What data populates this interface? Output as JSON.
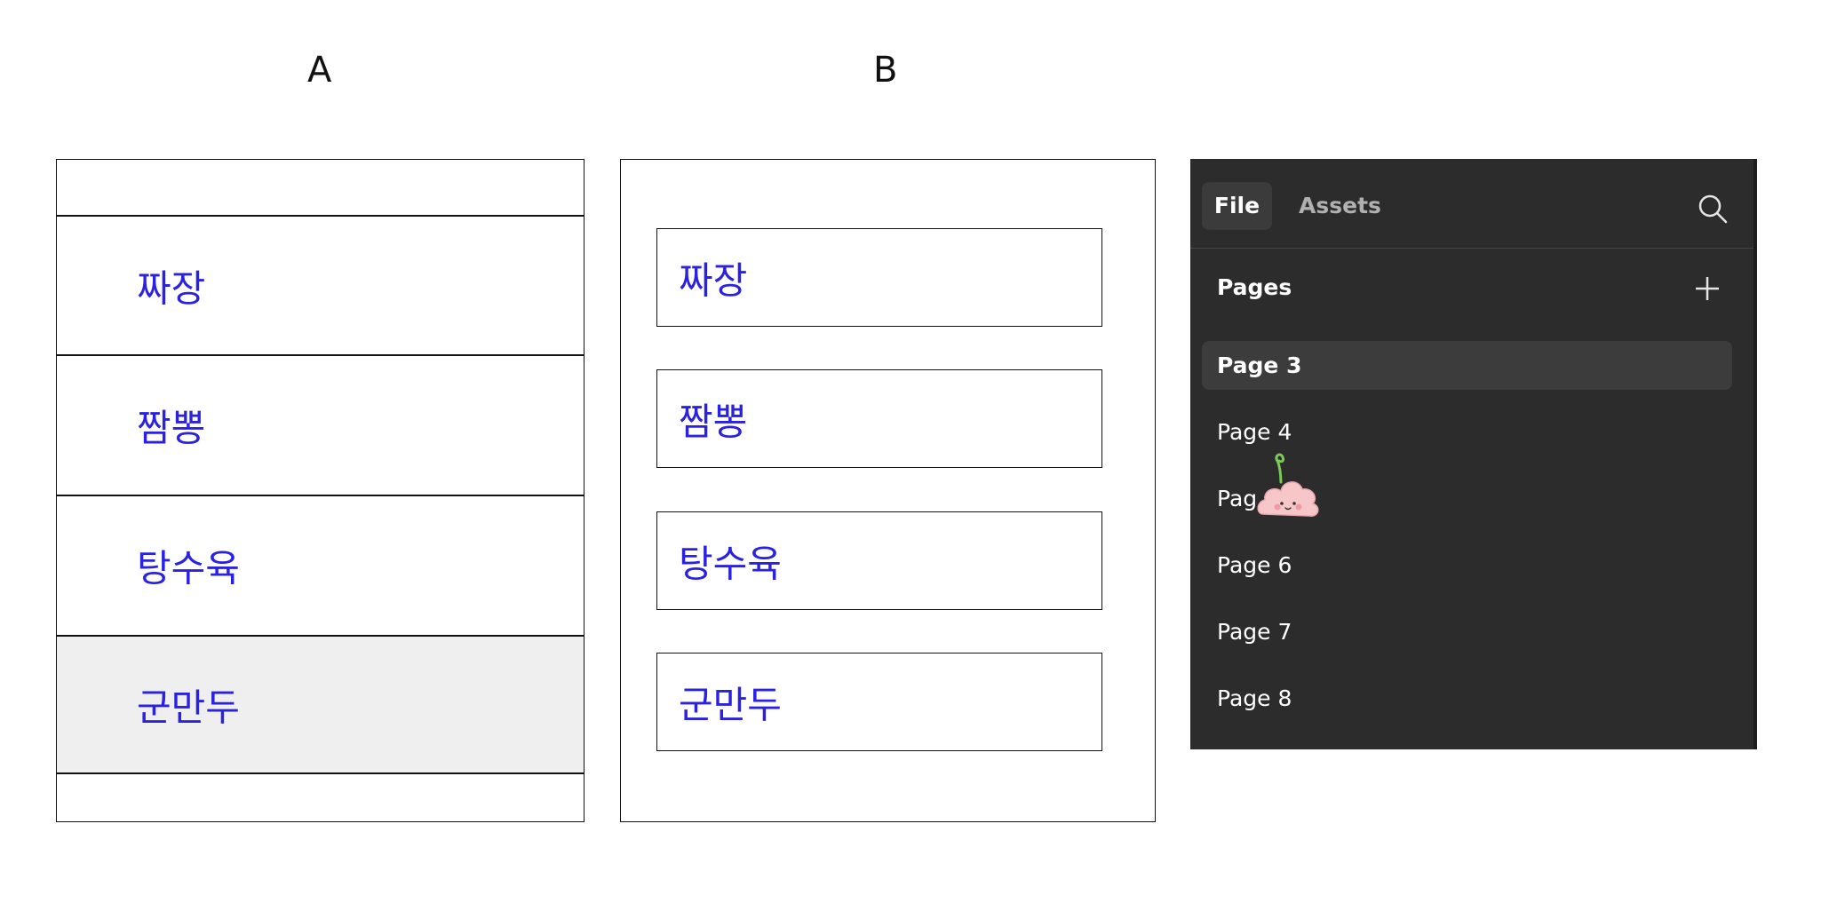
{
  "labels": {
    "a": "A",
    "b": "B"
  },
  "panel_a": {
    "rows": [
      "짜장",
      "짬뽕",
      "탕수육",
      "군만두"
    ]
  },
  "panel_b": {
    "items": [
      "짜장",
      "짬뽕",
      "탕수육",
      "군만두"
    ]
  },
  "dark_panel": {
    "tabs": {
      "file": "File",
      "assets": "Assets"
    },
    "pages_title": "Pages",
    "pages": [
      "Page 3",
      "Page 4",
      "Pag",
      "Page 6",
      "Page 7",
      "Page 8"
    ],
    "selected_page": "Page 3",
    "icons": {
      "search": "search-icon",
      "add": "plus-icon",
      "mascot": "cloud-mascot-icon"
    },
    "colors": {
      "panel_bg": "#2c2c2c",
      "selected_bg": "#3c3c3c",
      "text": "#ffffff",
      "muted_text": "#b0b0b0"
    }
  },
  "colors": {
    "korean_text": "#2a22e0",
    "selected_row_bg": "#efefef"
  }
}
